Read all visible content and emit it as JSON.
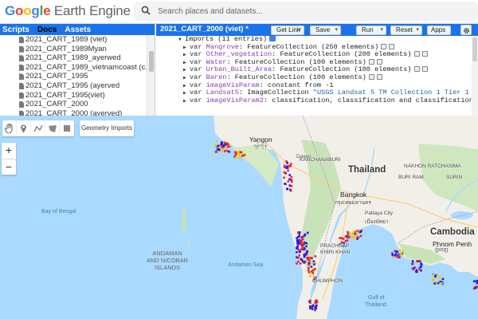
{
  "header": {
    "logo_google": "Google",
    "logo_product": "Earth Engine",
    "search_placeholder": "Search places and datasets..."
  },
  "left_panel": {
    "tabs": [
      "Scripts",
      "Docs",
      "Assets"
    ],
    "active_tab": "Docs",
    "scripts": [
      "2021_CART_1989 (viet)",
      "2021_CART_1989Myan",
      "2021_CART_1989_ayerwed",
      "2021_CART_1989_vietnamcoast (c...",
      "2021_CART_1995",
      "2021_CART_1995 (ayerved",
      "2021_CART_1995(viet)",
      "2021_CART_2000",
      "2021_CART_2000 (ayerved)"
    ]
  },
  "editor": {
    "file_title": "2021_CART_2000 (viet) *",
    "buttons": {
      "get_link": "Get Link",
      "save": "Save",
      "run": "Run",
      "reset": "Reset",
      "apps": "Apps"
    },
    "imports_header": "Imports (11 entries)",
    "var_keyword": "var",
    "imports": [
      {
        "name": "Mangrove",
        "value": "FeatureCollection (250 elements)",
        "icons": true
      },
      {
        "name": "Other_vegetation",
        "value": "FeatureCollection (200 elements)",
        "icons": true
      },
      {
        "name": "Water",
        "value": "FeatureCollection (100 elements)",
        "icons": true
      },
      {
        "name": "Urban_Built_Area",
        "value": "FeatureCollection (100 elements)",
        "icons": true
      },
      {
        "name": "Baren",
        "value": "FeatureCollection (100 elements)",
        "icons": true
      },
      {
        "name": "imageVisParam",
        "value": "constant from -1",
        "icons": false
      },
      {
        "name": "Landsat5",
        "value": "ImageCollection",
        "string": "\"USGS Landsat 5 TM Collection 1 Tier 1 ...",
        "icons": false
      },
      {
        "name": "imageVisParam2",
        "value": "classification, classification and classification...",
        "icons": false
      }
    ]
  },
  "map": {
    "toolbar_tools": [
      "hand-icon",
      "point-marker-icon",
      "line-icon",
      "polygon-icon",
      "rectangle-icon"
    ],
    "geometry_imports_label": "Geometry Imports",
    "zoom_in": "+",
    "zoom_out": "−",
    "labels": {
      "bay_of_bengal": "Bay of Bengal",
      "andaman_islands_1": "ANDAMAN",
      "andaman_islands_2": "AND NICOBAR",
      "andaman_islands_3": "ISLANDS",
      "andaman_sea": "Andaman Sea",
      "thailand": "Thailand",
      "cambodia": "Cambodia",
      "bangkok": "Bangkok",
      "bangkok_thai": "กรุงเทพมหานคร",
      "yangon": "Yangon",
      "yangon_mm": "ရန်ကုန်",
      "nakhon_ratchasima": "NAKHON RATCHASIMA",
      "buri_ram": "BURI RAM",
      "surin": "SURIN",
      "kanchanaburi": "KANCHANABURI",
      "phnom_penh": "Phnom Penh",
      "phnom_penh_km": "ភ្នំពេញ",
      "pattaya": "Pattaya City",
      "pattaya_th": "เมืองพัทยา",
      "prachuap": "PRACHUAP",
      "khiri_khan": "KHIRI KHAN",
      "chumphon": "CHUMPHON",
      "gulf_of_thailand_1": "Gulf of",
      "gulf_of_thailand_2": "Thailand",
      "dawei": "Dawei"
    },
    "colors": {
      "sea": "#aadaff",
      "land": "#f2efe9",
      "forest": "#c9e3b8",
      "mangrove": "#e8252a",
      "water_points": "#1a1aff",
      "veg_points": "#f5c400"
    }
  }
}
